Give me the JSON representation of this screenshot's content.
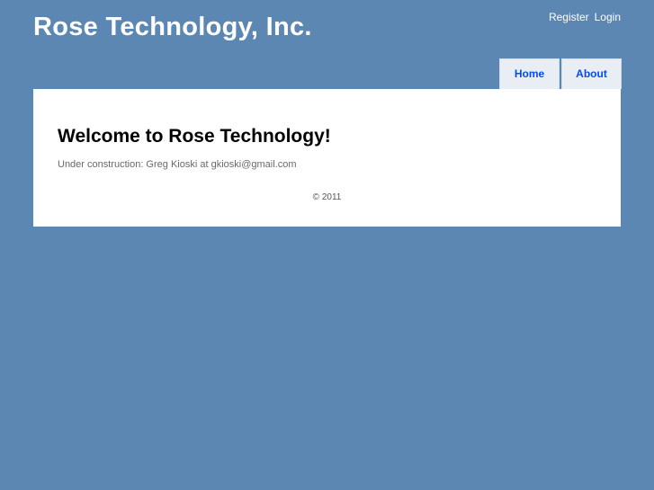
{
  "header": {
    "title": "Rose Technology, Inc.",
    "links": {
      "register": "Register",
      "login": "Login"
    }
  },
  "menu": {
    "tabs": [
      {
        "label": "Home"
      },
      {
        "label": "About"
      }
    ]
  },
  "main": {
    "heading": "Welcome to Rose Technology!",
    "body_text": "Under construction: Greg Kioski at gkioski@gmail.com",
    "footer": "© 2011"
  },
  "colors": {
    "page_background": "#5c87b2",
    "tab_background": "#e8eef4",
    "tab_text": "#034af3",
    "content_background": "#ffffff"
  }
}
